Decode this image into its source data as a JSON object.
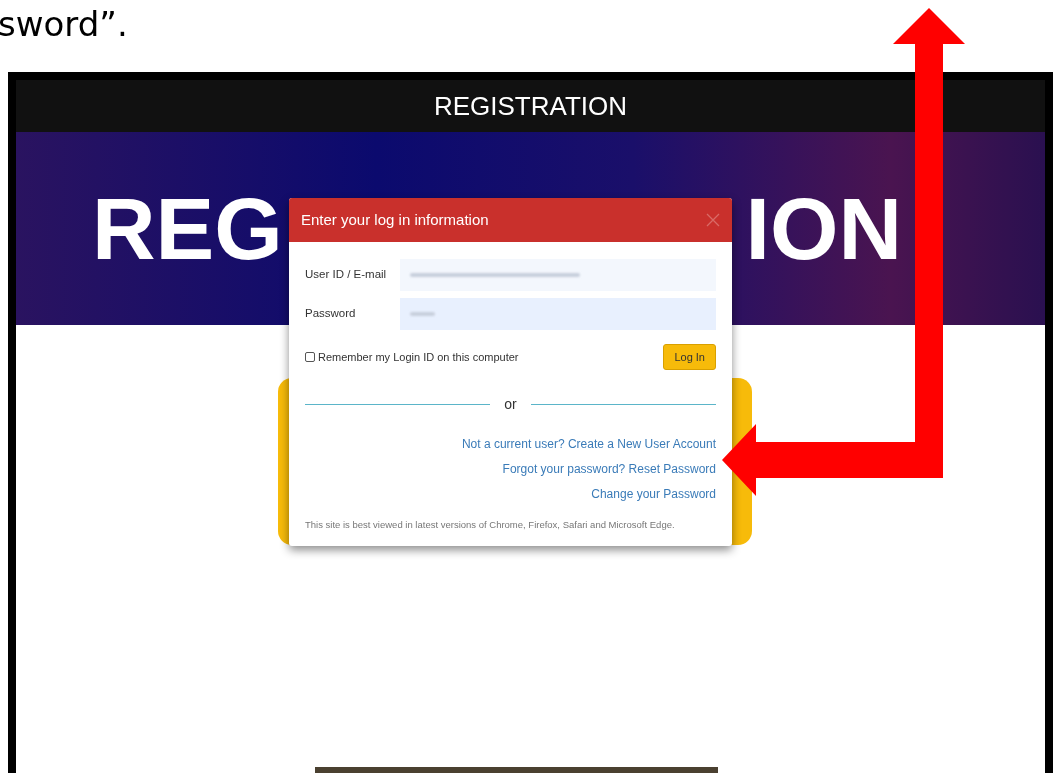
{
  "caption_fragment": "sword”.",
  "site": {
    "header_title": "REGISTRATION",
    "banner_text_left": "REG",
    "banner_text_right": "ION"
  },
  "login_dialog": {
    "title": "Enter your log in information",
    "fields": [
      {
        "label": "User ID / E-mail",
        "kind": "text"
      },
      {
        "label": "Password",
        "kind": "password"
      }
    ],
    "remember": {
      "label": "Remember my Login ID on this computer",
      "checked": false
    },
    "login_button": "Log In",
    "divider_text": "or",
    "links": [
      "Not a current user? Create a New User Account",
      "Forgot your password? Reset Password",
      "Change your Password"
    ],
    "footnote": "This site is best viewed in latest versions of Chrome, Firefox, Safari and Microsoft Edge."
  }
}
